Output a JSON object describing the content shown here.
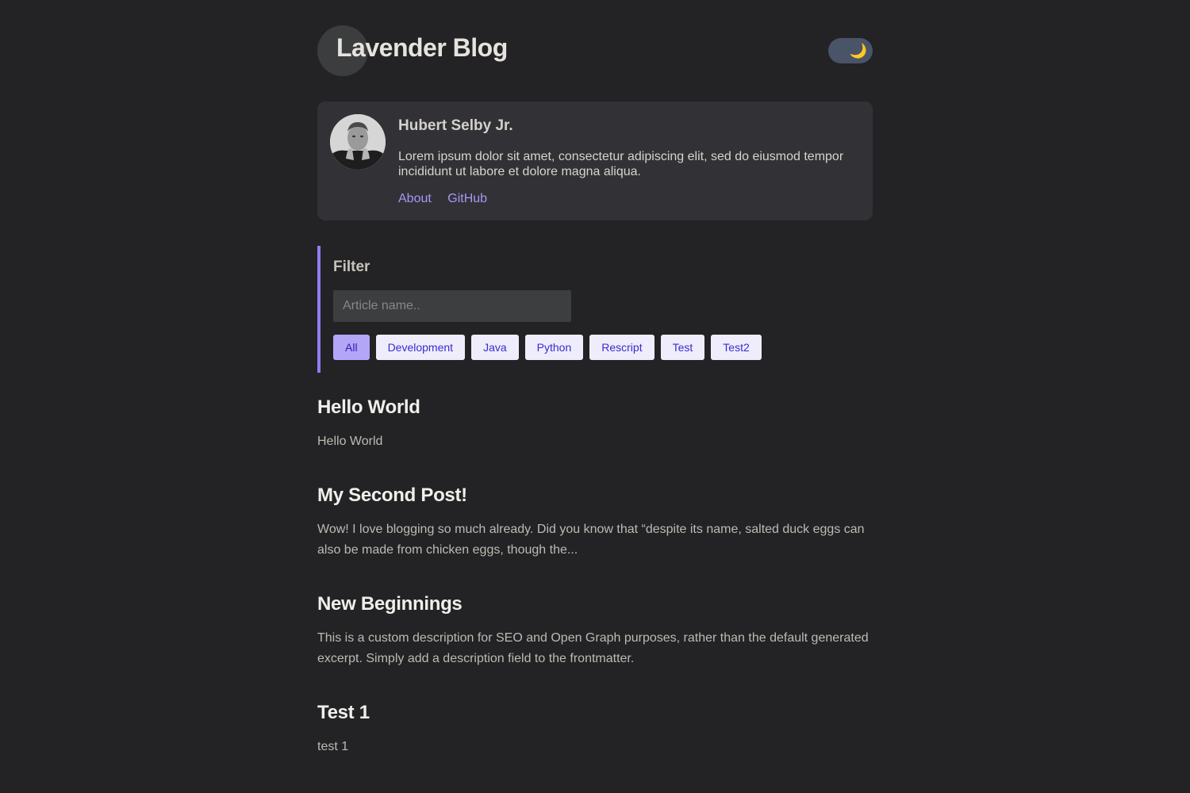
{
  "header": {
    "site_title": "Lavender Blog",
    "theme_toggle_icon": "🌙"
  },
  "profile": {
    "name": "Hubert Selby Jr.",
    "bio": "Lorem ipsum dolor sit amet, consectetur adipiscing elit, sed do eiusmod tempor incididunt ut labore et dolore magna aliqua.",
    "links": [
      "About",
      "GitHub"
    ]
  },
  "filter": {
    "title": "Filter",
    "placeholder": "Article name..",
    "tags": [
      "All",
      "Development",
      "Java",
      "Python",
      "Rescript",
      "Test",
      "Test2"
    ],
    "active_tag": "All"
  },
  "posts": [
    {
      "title": "Hello World",
      "excerpt": "Hello World"
    },
    {
      "title": "My Second Post!",
      "excerpt": "Wow! I love blogging so much already. Did you know that “despite its name, salted duck eggs can also be made from chicken eggs, though the..."
    },
    {
      "title": "New Beginnings",
      "excerpt": "This is a custom description for SEO and Open Graph purposes, rather than the default generated excerpt. Simply add a description field to the frontmatter."
    },
    {
      "title": "Test 1",
      "excerpt": "test 1"
    }
  ],
  "colors": {
    "background": "#232325",
    "card": "#323236",
    "accent": "#8f7cf0",
    "link": "#a996f5"
  }
}
